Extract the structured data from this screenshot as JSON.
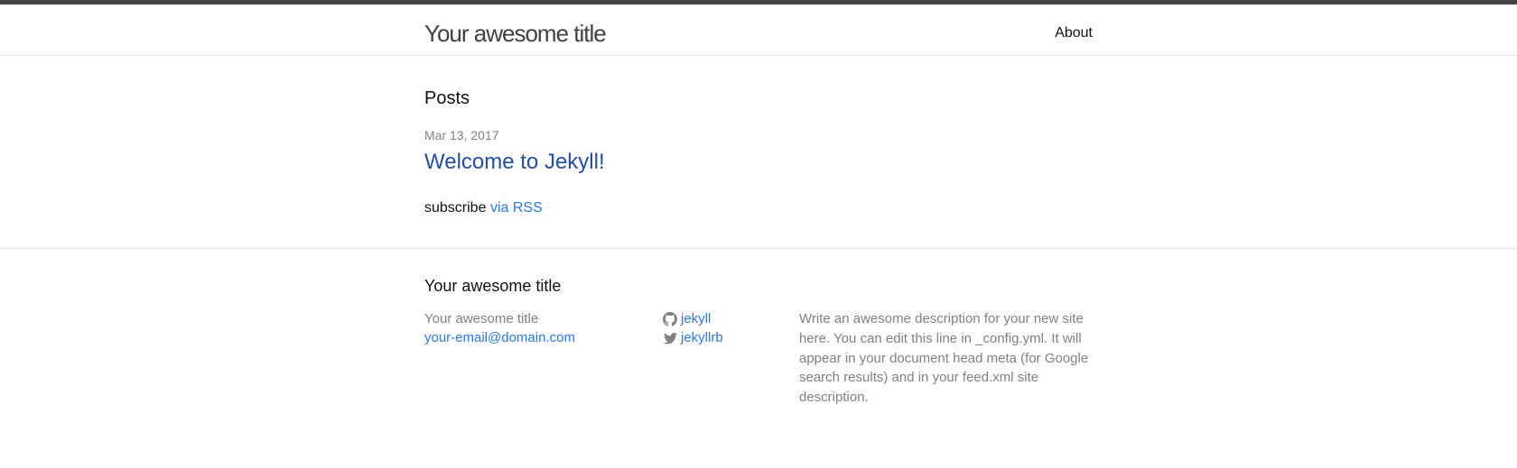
{
  "header": {
    "site_title": "Your awesome title",
    "nav": [
      {
        "label": "About"
      }
    ]
  },
  "main": {
    "heading": "Posts",
    "posts": [
      {
        "date": "Mar 13, 2017",
        "title": "Welcome to Jekyll!"
      }
    ],
    "subscribe_text": "subscribe",
    "rss_link": "via RSS"
  },
  "footer": {
    "heading": "Your awesome title",
    "name": "Your awesome title",
    "email": "your-email@domain.com",
    "social": [
      {
        "icon": "github-icon",
        "label": "jekyll"
      },
      {
        "icon": "twitter-icon",
        "label": "jekyllrb"
      }
    ],
    "description": "Write an awesome description for your new site here. You can edit this line in _config.yml. It will appear in your document head meta (for Google search results) and in your feed.xml site description."
  },
  "colors": {
    "link": "#2a7ae2",
    "muted": "#828282",
    "topbar": "#424242"
  }
}
